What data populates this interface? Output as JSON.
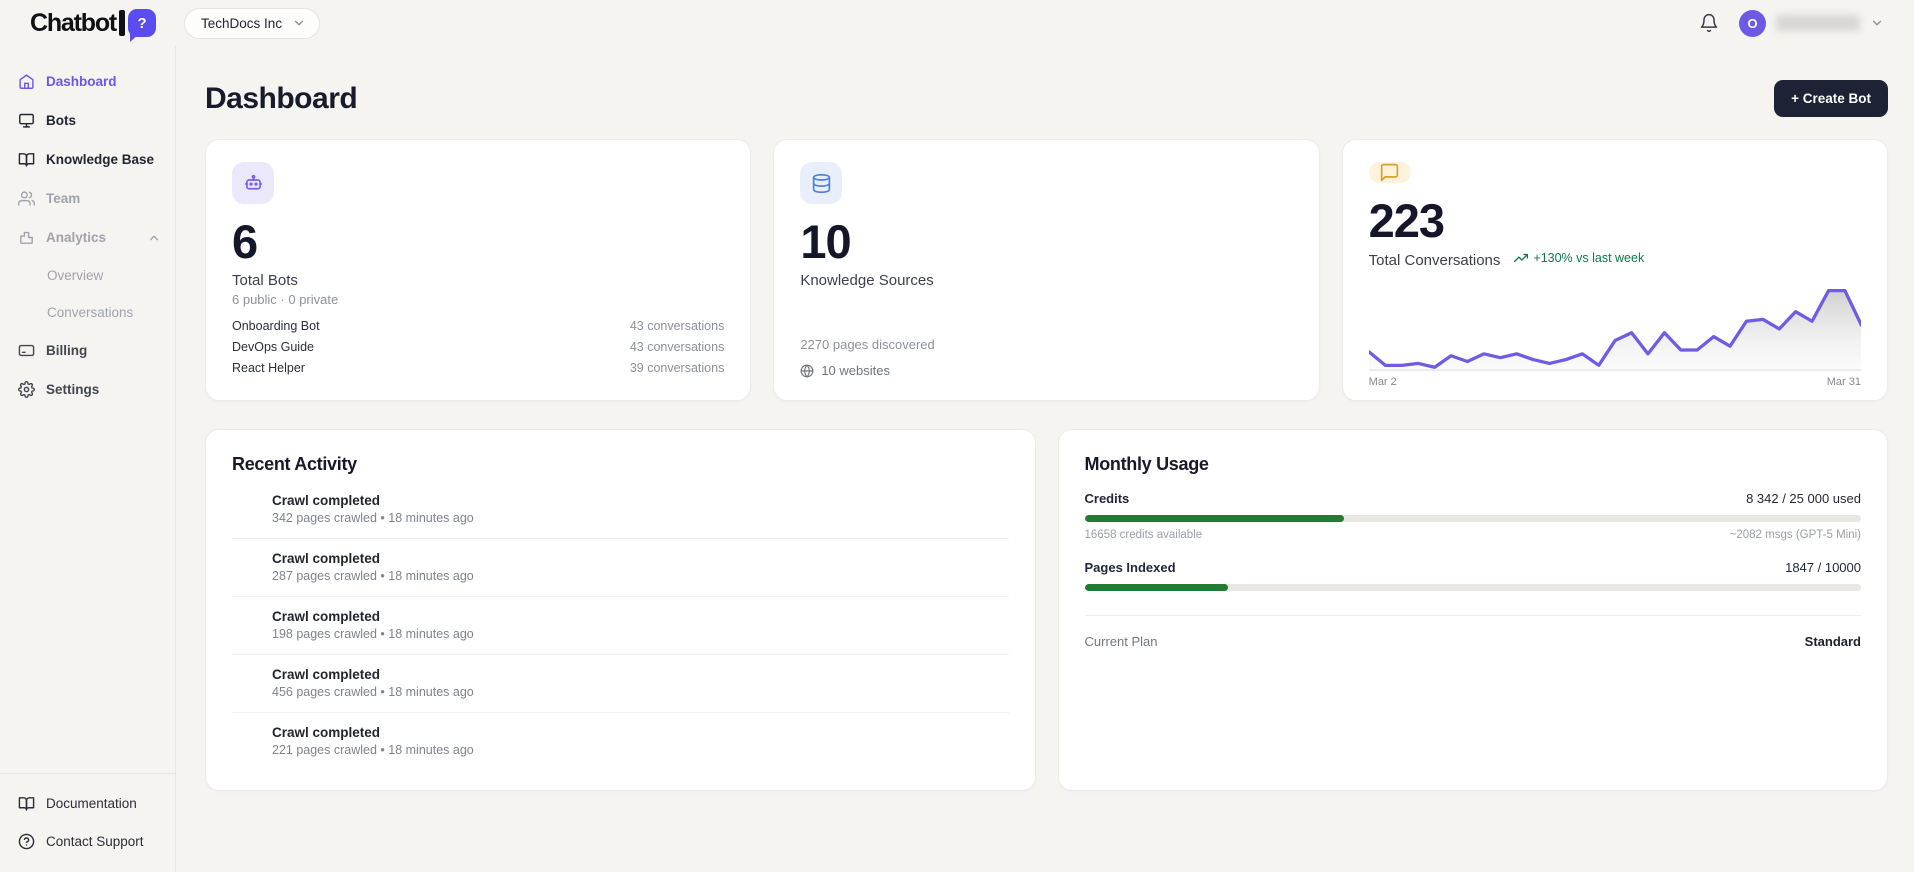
{
  "brand": {
    "name": "Chatbot",
    "bubble_glyph": "?"
  },
  "workspace": {
    "name": "TechDocs Inc"
  },
  "header": {
    "avatar_initial": "O"
  },
  "sidebar": {
    "items": [
      {
        "label": "Dashboard",
        "active": true
      },
      {
        "label": "Bots"
      },
      {
        "label": "Knowledge Base"
      },
      {
        "label": "Team"
      },
      {
        "label": "Analytics",
        "expanded": true
      },
      {
        "label": "Overview"
      },
      {
        "label": "Conversations"
      },
      {
        "label": "Billing"
      },
      {
        "label": "Settings"
      }
    ],
    "footer_items": [
      {
        "label": "Documentation"
      },
      {
        "label": "Contact Support"
      }
    ]
  },
  "page": {
    "title": "Dashboard",
    "create_bot_label": "+ Create Bot"
  },
  "stats": {
    "bots": {
      "value": "6",
      "label": "Total Bots",
      "breakdown": "6 public · 0 private",
      "top_bots": [
        {
          "name": "Onboarding Bot",
          "conversations": "43 conversations"
        },
        {
          "name": "DevOps Guide",
          "conversations": "43 conversations"
        },
        {
          "name": "React Helper",
          "conversations": "39 conversations"
        }
      ]
    },
    "knowledge": {
      "value": "10",
      "label": "Knowledge Sources",
      "pages": "2270 pages discovered",
      "websites": "10 websites"
    },
    "conversations": {
      "value": "223",
      "label": "Total Conversations",
      "trend": "+130% vs last week"
    }
  },
  "chart_data": {
    "type": "area",
    "title": "Total Conversations daily sparkline",
    "x_start_label": "Mar 2",
    "x_end_label": "Mar 31",
    "values": [
      4,
      0.5,
      0.5,
      1,
      0,
      3,
      1.5,
      3.5,
      2.5,
      3.5,
      2,
      1,
      2,
      3.5,
      0.5,
      7,
      9,
      3.5,
      9,
      4.5,
      4.5,
      8,
      5.5,
      12,
      12.5,
      10,
      14.5,
      12,
      20,
      20,
      11
    ],
    "ylim": [
      0,
      20
    ],
    "line_color": "#6e5be6",
    "legend": "none",
    "grid": false
  },
  "activity": {
    "title": "Recent Activity",
    "items": [
      {
        "title": "Crawl completed",
        "meta": "342 pages crawled • 18 minutes ago"
      },
      {
        "title": "Crawl completed",
        "meta": "287 pages crawled • 18 minutes ago"
      },
      {
        "title": "Crawl completed",
        "meta": "198 pages crawled • 18 minutes ago"
      },
      {
        "title": "Crawl completed",
        "meta": "456 pages crawled • 18 minutes ago"
      },
      {
        "title": "Crawl completed",
        "meta": "221 pages crawled • 18 minutes ago"
      }
    ]
  },
  "usage": {
    "title": "Monthly Usage",
    "credits": {
      "label": "Credits",
      "value": "8 342 / 25 000 used",
      "pct": 33.4,
      "sub_left": "16658 credits available",
      "sub_right": "~2082 msgs (GPT-5 Mini)"
    },
    "pages": {
      "label": "Pages Indexed",
      "value": "1847 / 10000",
      "pct": 18.5
    },
    "plan": {
      "label": "Current Plan",
      "value": "Standard"
    }
  },
  "colors": {
    "accent_purple": "#6a56e8",
    "logo_bubble": "#5b4cf0",
    "trend_green": "#0d7a4c",
    "progress_green": "#1e7c33",
    "button_dark": "#1d2235"
  }
}
